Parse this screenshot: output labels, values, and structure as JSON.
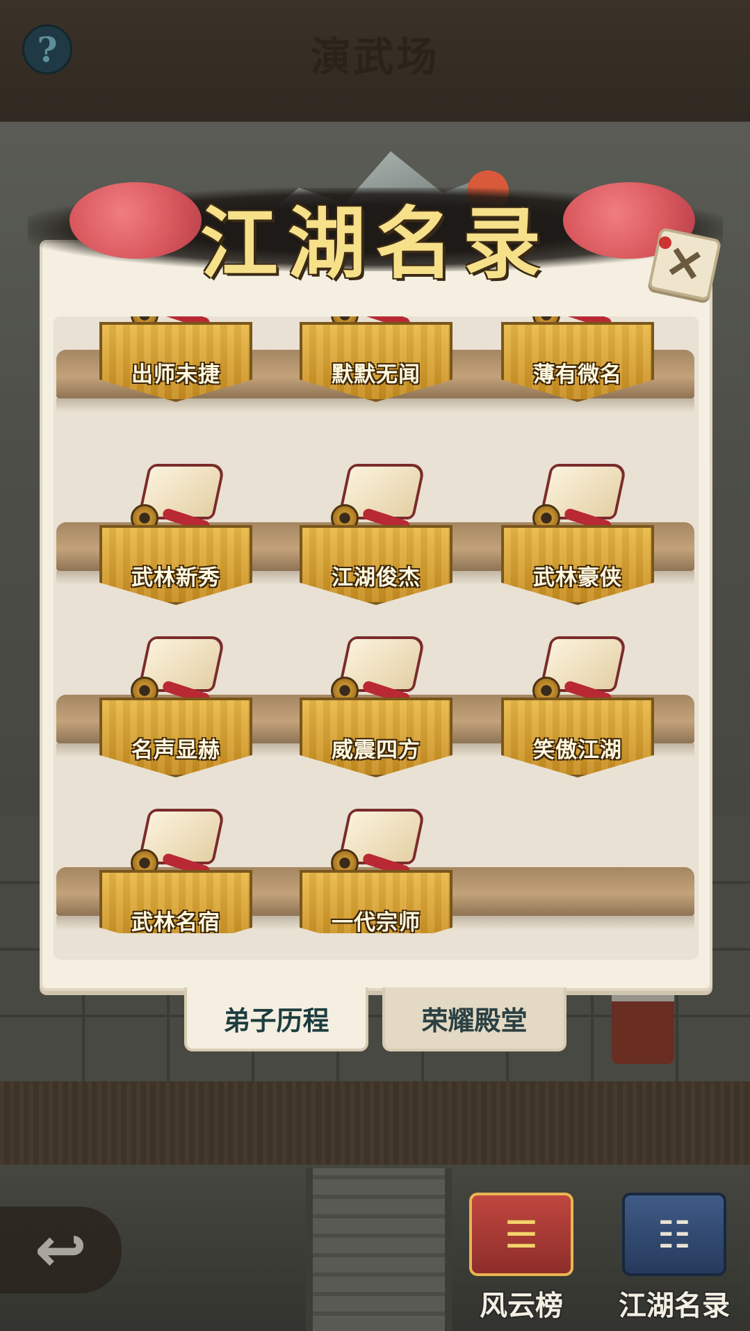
{
  "header": {
    "title": "演武场",
    "help_icon": "question-mark-icon",
    "help_label": "?"
  },
  "dialog": {
    "banner_title": "江湖名录",
    "close_icon": "close-x-icon",
    "close_label": "✕",
    "ranks": [
      {
        "label": "出师未捷"
      },
      {
        "label": "默默无闻"
      },
      {
        "label": "薄有微名"
      },
      {
        "label": "武林新秀"
      },
      {
        "label": "江湖俊杰"
      },
      {
        "label": "武林豪侠"
      },
      {
        "label": "名声显赫"
      },
      {
        "label": "威震四方"
      },
      {
        "label": "笑傲江湖"
      },
      {
        "label": "武林名宿"
      },
      {
        "label": "一代宗师"
      }
    ],
    "tabs": [
      {
        "label": "弟子历程",
        "active": true
      },
      {
        "label": "荣耀殿堂",
        "active": false
      }
    ]
  },
  "bottom_nav": {
    "back_icon": "back-arrow-icon",
    "back_label": "↩",
    "items": [
      {
        "label": "风云榜",
        "icon": "rank-scroll-icon",
        "glyph": "☰"
      },
      {
        "label": "江湖名录",
        "icon": "book-icon",
        "glyph": "☷"
      }
    ]
  },
  "colors": {
    "panel_bg": "#e9e1d3",
    "plaque_gold": "#e9b845",
    "banner_title": "#f7e08a",
    "tab_text": "#1d3d3f"
  }
}
